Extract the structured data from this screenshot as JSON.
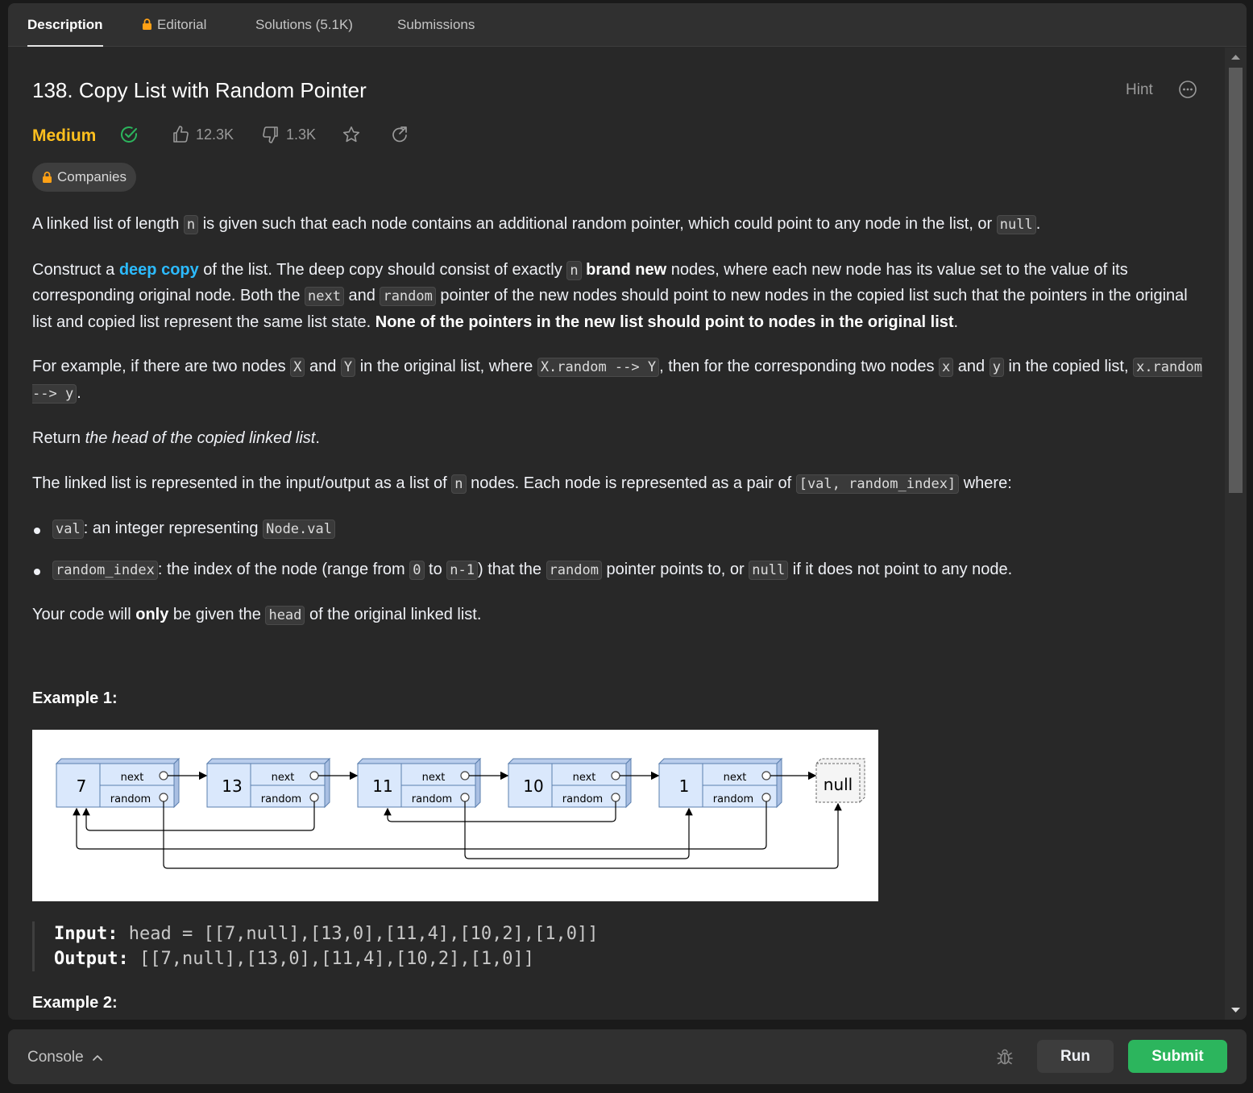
{
  "tabs": [
    {
      "label": "Description",
      "active": true
    },
    {
      "label": "Editorial",
      "locked": true
    },
    {
      "label": "Solutions (5.1K)"
    },
    {
      "label": "Submissions"
    }
  ],
  "problem": {
    "title": "138. Copy List with Random Pointer",
    "hint": "Hint",
    "difficulty": "Medium",
    "likes": "12.3K",
    "dislikes": "1.3K",
    "companies": "Companies"
  },
  "description": {
    "p1": {
      "a": "A linked list of length ",
      "code1": "n",
      "b": " is given such that each node contains an additional random pointer, which could point to any node in the list, or ",
      "code2": "null",
      "c": "."
    },
    "p2": {
      "a": "Construct a ",
      "link": "deep copy",
      "b": " of the list. The deep copy should consist of exactly ",
      "code1": "n",
      "bold1": "brand new",
      "c": " nodes, where each new node has its value set to the value of its corresponding original node. Both the ",
      "code2": "next",
      "d": " and ",
      "code3": "random",
      "e": " pointer of the new nodes should point to new nodes in the copied list such that the pointers in the original list and copied list represent the same list state. ",
      "bold2": "None of the pointers in the new list should point to nodes in the original list",
      "f": "."
    },
    "p3": {
      "a": "For example, if there are two nodes ",
      "code1": "X",
      "b": " and ",
      "code2": "Y",
      "c": " in the original list, where ",
      "code3": "X.random --> Y",
      "d": ", then for the corresponding two nodes ",
      "code4": "x",
      "e": " and ",
      "code5": "y",
      "f": " in the copied list, ",
      "code6": "x.random --> y",
      "g": "."
    },
    "p4": {
      "a": "Return ",
      "em": "the head of the copied linked list",
      "b": "."
    },
    "p5": {
      "a": "The linked list is represented in the input/output as a list of ",
      "code1": "n",
      "b": " nodes. Each node is represented as a pair of ",
      "code2": "[val, random_index]",
      "c": " where:"
    },
    "li1": {
      "code1": "val",
      "a": ": an integer representing ",
      "code2": "Node.val"
    },
    "li2": {
      "code1": "random_index",
      "a": ": the index of the node (range from ",
      "code2": "0",
      "b": " to ",
      "code3": "n-1",
      "c": ") that the ",
      "code4": "random",
      "d": " pointer points to, or ",
      "code5": "null",
      "e": " if it does not point to any node."
    },
    "p6": {
      "a": "Your code will ",
      "bold": "only",
      "b": " be given the ",
      "code": "head",
      "c": " of the original linked list."
    }
  },
  "example1": {
    "title": "Example 1:",
    "input_label": "Input:",
    "input_value": "head = [[7,null],[13,0],[11,4],[10,2],[1,0]]",
    "output_label": "Output:",
    "output_value": "[[7,null],[13,0],[11,4],[10,2],[1,0]]"
  },
  "example2": {
    "title": "Example 2:"
  },
  "diagram": {
    "nodes": [
      "7",
      "13",
      "11",
      "10",
      "1"
    ],
    "next_label": "next",
    "random_label": "random",
    "null_label": "null",
    "random_index": [
      null,
      0,
      4,
      2,
      0
    ]
  },
  "console": {
    "label": "Console",
    "run": "Run",
    "submit": "Submit"
  },
  "colors": {
    "medium": "#ffc01e",
    "accent_link": "#2cbbff",
    "submit": "#2cb55d",
    "solved": "#2cb55d"
  }
}
